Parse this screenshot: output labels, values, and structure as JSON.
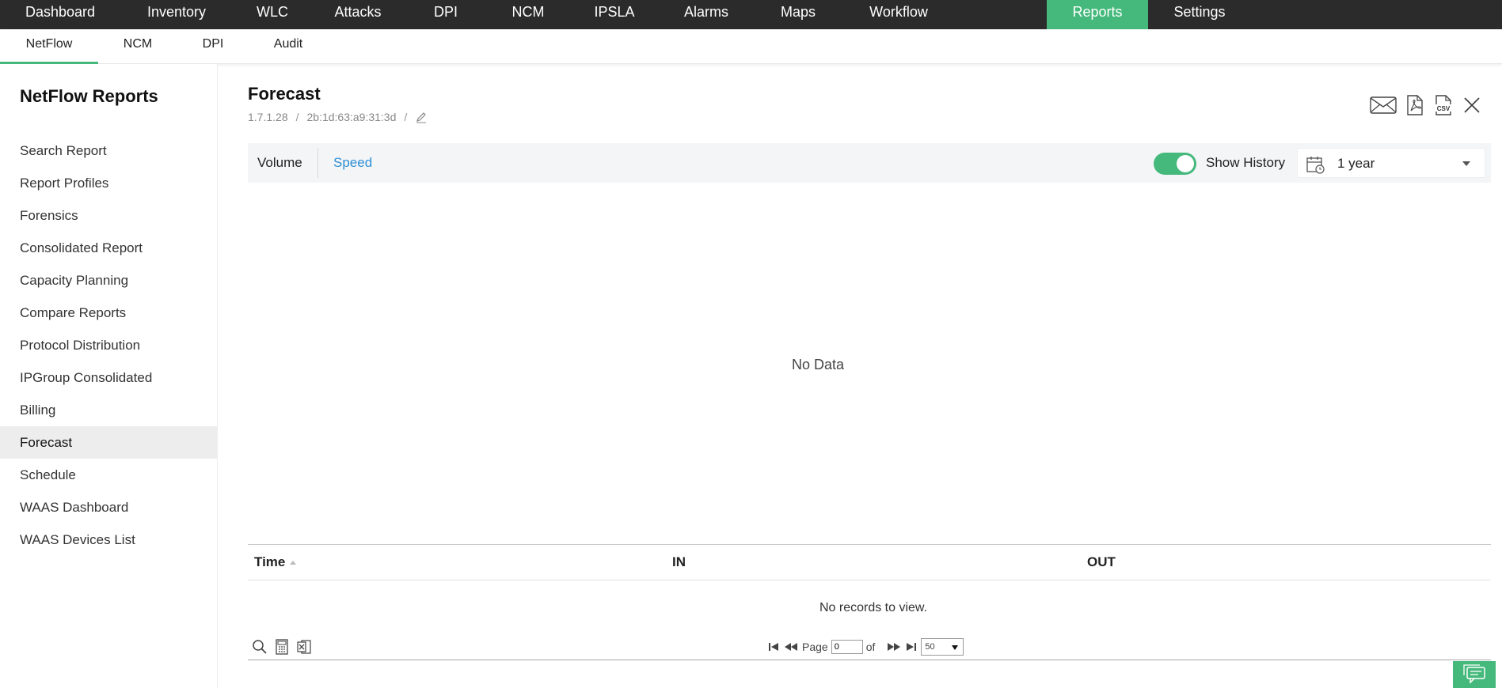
{
  "top_nav": [
    {
      "label": "Dashboard"
    },
    {
      "label": "Inventory"
    },
    {
      "label": "WLC"
    },
    {
      "label": "Attacks"
    },
    {
      "label": "DPI"
    },
    {
      "label": "NCM"
    },
    {
      "label": "IPSLA"
    },
    {
      "label": "Alarms"
    },
    {
      "label": "Maps"
    },
    {
      "label": "Workflow"
    },
    {
      "label": "Reports"
    },
    {
      "label": "Settings"
    }
  ],
  "sub_nav": [
    {
      "label": "NetFlow"
    },
    {
      "label": "NCM"
    },
    {
      "label": "DPI"
    },
    {
      "label": "Audit"
    }
  ],
  "sidebar": {
    "title": "NetFlow Reports",
    "items": [
      {
        "label": "Search Report"
      },
      {
        "label": "Report Profiles"
      },
      {
        "label": "Forensics"
      },
      {
        "label": "Consolidated Report"
      },
      {
        "label": "Capacity Planning"
      },
      {
        "label": "Compare Reports"
      },
      {
        "label": "Protocol Distribution"
      },
      {
        "label": "IPGroup Consolidated"
      },
      {
        "label": "Billing"
      },
      {
        "label": "Forecast"
      },
      {
        "label": "Schedule"
      },
      {
        "label": "WAAS Dashboard"
      },
      {
        "label": "WAAS Devices List"
      }
    ]
  },
  "main": {
    "title": "Forecast",
    "breadcrumb": {
      "device": "1.7.1.28",
      "interface": "2b:1d:63:a9:31:3d",
      "separator": "/"
    },
    "tabs": {
      "volume": "Volume",
      "speed": "Speed"
    },
    "show_history_label": "Show History",
    "period": "1 year",
    "no_data": "No Data"
  },
  "grid": {
    "columns": [
      "Time",
      "IN",
      "OUT"
    ],
    "empty_message": "No records to view.",
    "pager": {
      "page_label": "Page",
      "page_value": "0",
      "of_label": "of",
      "page_size": "50"
    }
  },
  "colors": {
    "accent": "#45b97c",
    "link": "#2d8fd5",
    "topbar": "#2b2b2b"
  }
}
